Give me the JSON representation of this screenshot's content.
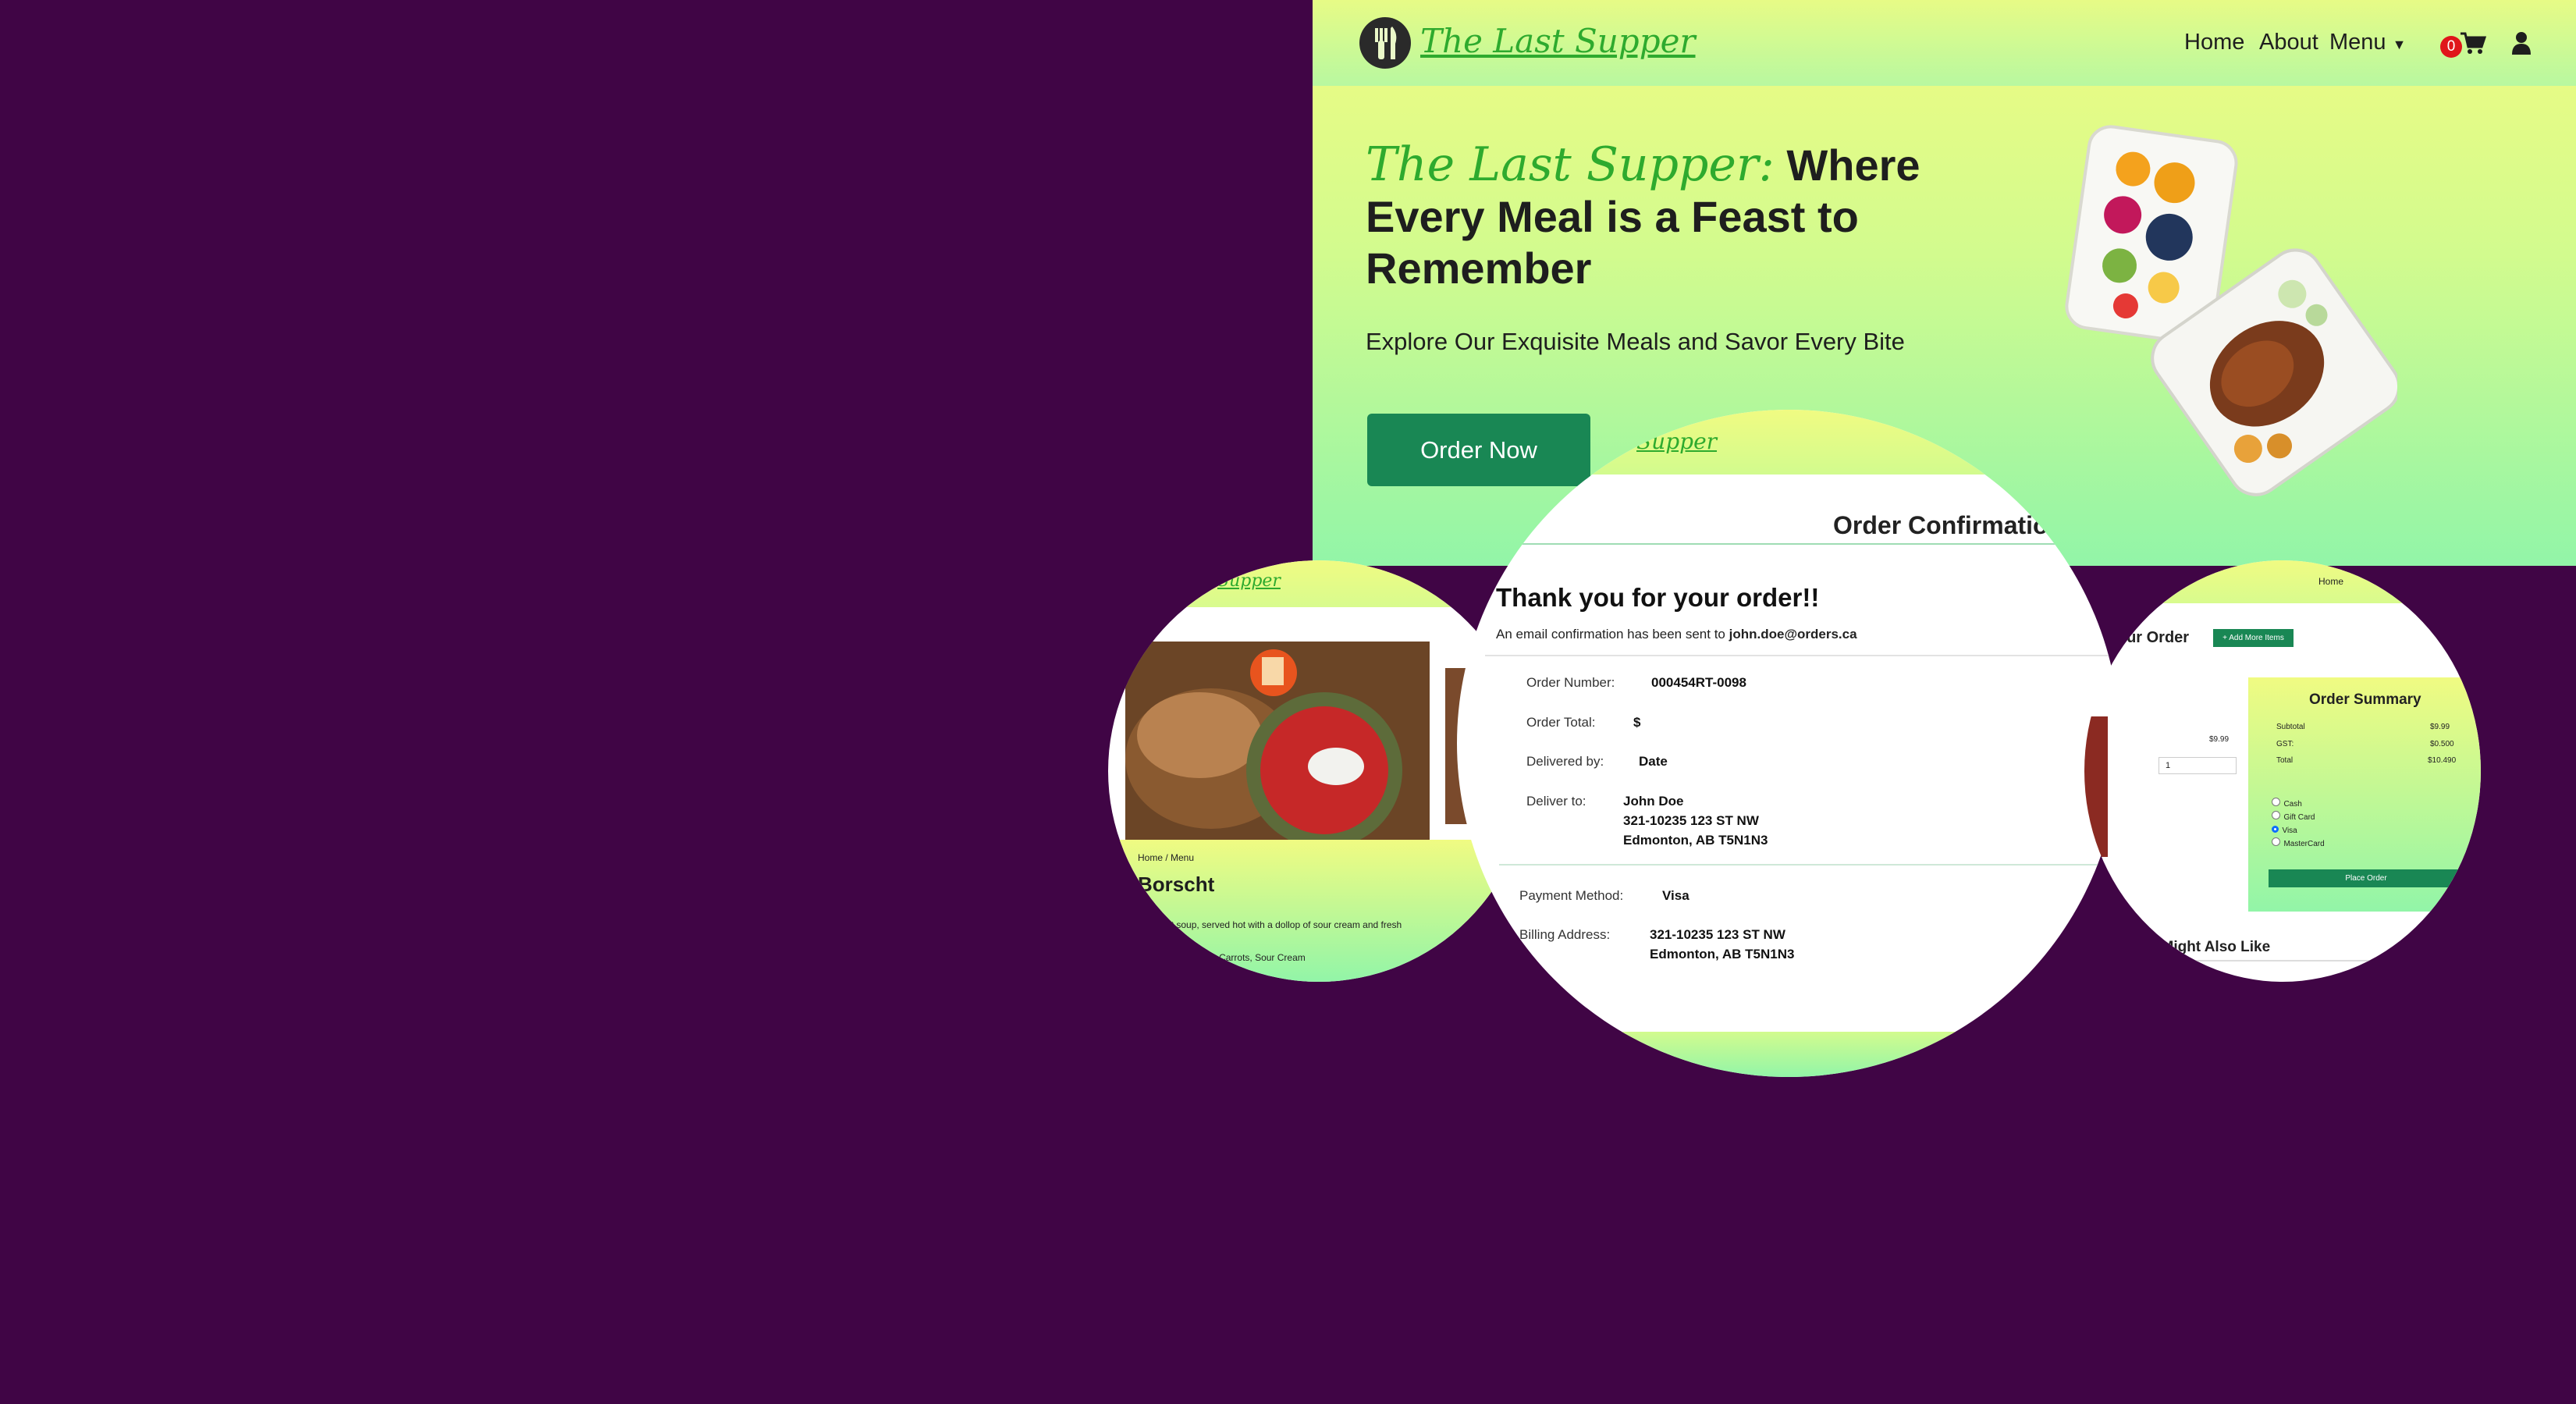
{
  "nav": {
    "brand": "The Last Supper",
    "links": [
      "Home",
      "About",
      "Menu"
    ],
    "cart_count": "0"
  },
  "hero": {
    "title_brand": "The Last Supper:",
    "title_rest": "Where Every Meal is a Feast to Remember",
    "subtitle": "Explore Our Exquisite Meals and Savor Every Bite",
    "order_button": "Order Now"
  },
  "preview_left": {
    "brand": "Supper",
    "breadcrumb": "Home / Menu",
    "dish": "Borscht",
    "description": "...al beet soup, served hot with a dollop of sour cream and fresh",
    "ingredients": "...bbage, Potatoes, Carrots, Sour Cream"
  },
  "confirmation": {
    "brand": "Supper",
    "title": "Order Confirmatio",
    "thanks": "Thank you for your order!!",
    "email_text": "An email confirmation has been sent to",
    "email": "john.doe@orders.ca",
    "order_number_label": "Order Number:",
    "order_number": "000454RT-0098",
    "order_total_label": "Order Total:",
    "order_total": "$",
    "delivered_by_label": "Delivered by:",
    "delivered_by": "Date",
    "deliver_to_label": "Deliver to:",
    "deliver_to": [
      "John Doe",
      "321-10235 123 ST NW",
      "Edmonton, AB T5N1N3"
    ],
    "payment_method_label": "Payment Method:",
    "payment_method": "Visa",
    "billing_address_label": "Billing Address:",
    "billing_address": [
      "321-10235 123 ST NW",
      "Edmonton, AB T5N1N3"
    ]
  },
  "preview_right": {
    "breadcrumb": "Home",
    "your_order": "Your Order",
    "add_more": "+ Add More Items",
    "item_price": "$9.99",
    "item_qty": "1",
    "summary_title": "Order Summary",
    "summary": [
      {
        "label": "Subtotal",
        "value": "$9.99"
      },
      {
        "label": "GST:",
        "value": "$0.500"
      },
      {
        "label": "Total",
        "value": "$10.490"
      }
    ],
    "payments": [
      "Cash",
      "Gift Card",
      "Visa",
      "MasterCard"
    ],
    "selected_payment": "Visa",
    "place_order": "Place Order",
    "also_like": "ou Might Also Like"
  }
}
